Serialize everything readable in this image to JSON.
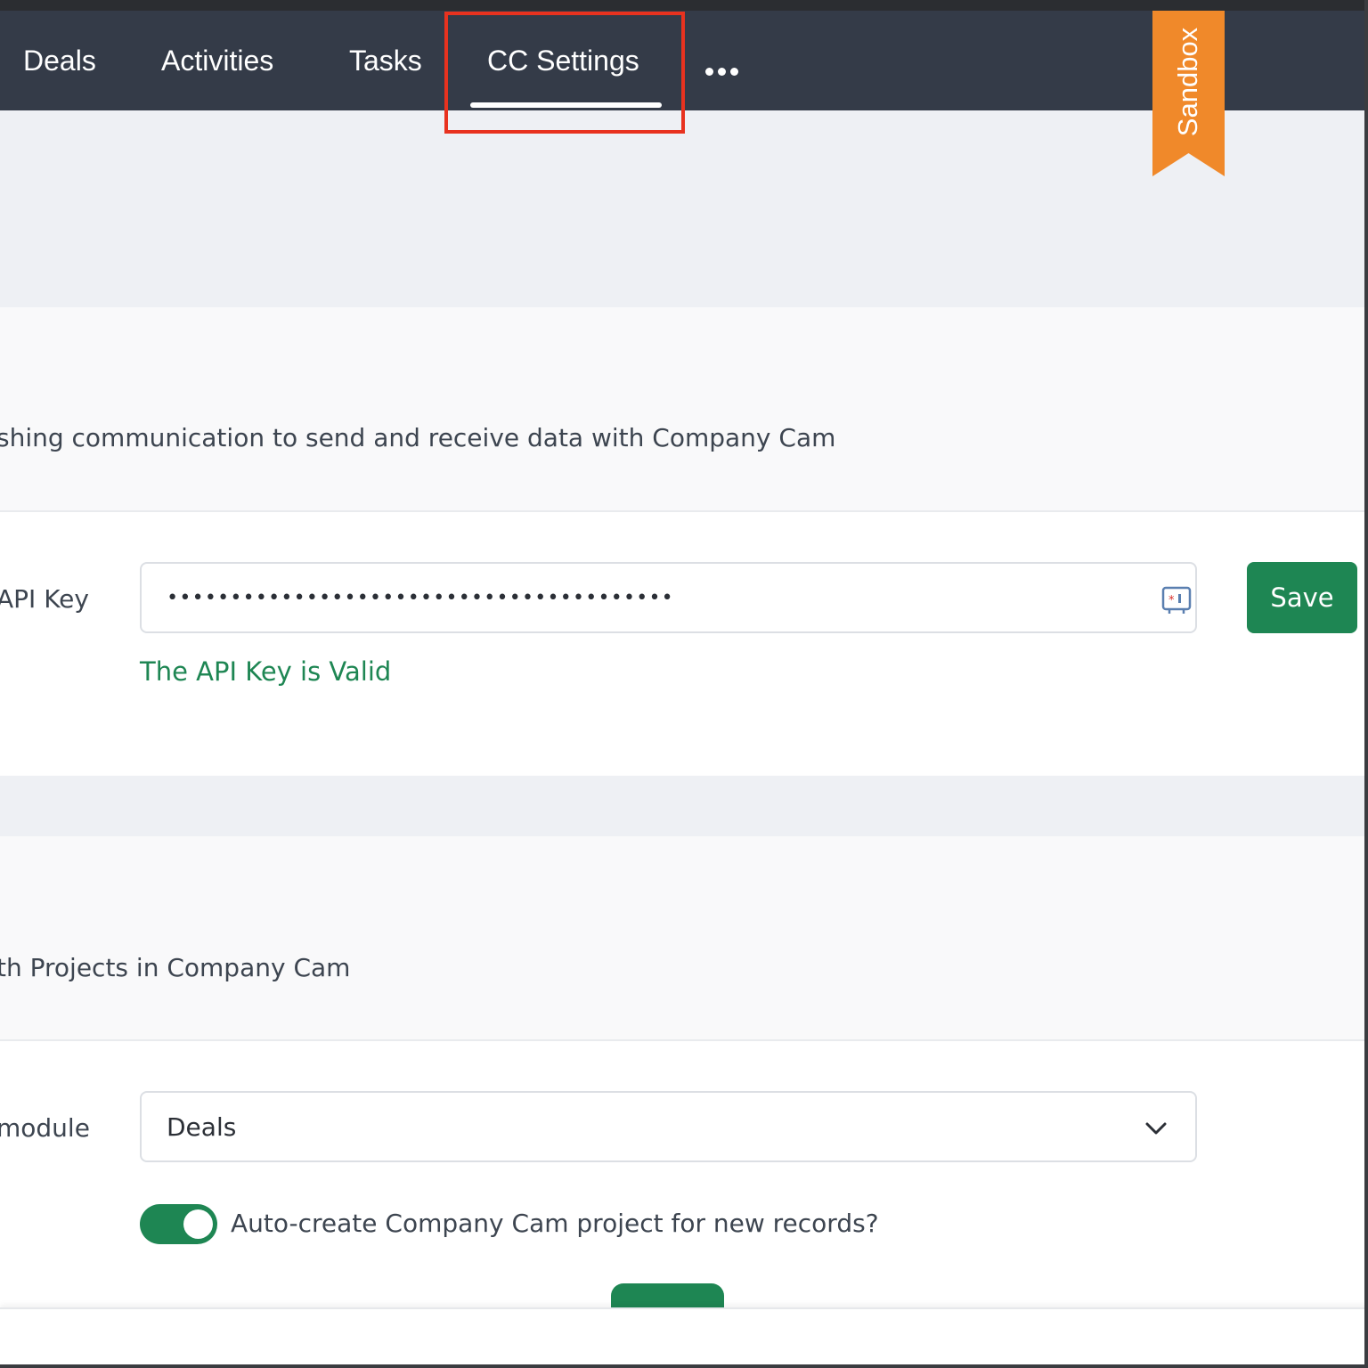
{
  "nav": {
    "tabs": [
      {
        "label": "Deals"
      },
      {
        "label": "Activities"
      },
      {
        "label": "Tasks"
      },
      {
        "label": "CC Settings",
        "active": true
      }
    ],
    "more_icon": "more-horizontal-icon",
    "highlight_color": "#e8321f"
  },
  "badge": {
    "label": "Sandbox",
    "color": "#f0892a"
  },
  "connection": {
    "description": "shing communication to send and receive data with Company Cam",
    "api_key_label": "API Key",
    "api_key_value": "••••••••••••••••••••••••••••••••••••••••",
    "key_icon": "password-manager-icon",
    "save_label": "Save",
    "status_message": "The API Key is Valid"
  },
  "sync": {
    "description": "th Projects in Company Cam",
    "module_label": "module",
    "module_value": "Deals",
    "chevron_icon": "chevron-down-icon",
    "auto_create_label": "Auto-create Company Cam project for new records?",
    "auto_create_enabled": true
  },
  "colors": {
    "primary": "#1e8653",
    "nav_background": "#343b48"
  }
}
